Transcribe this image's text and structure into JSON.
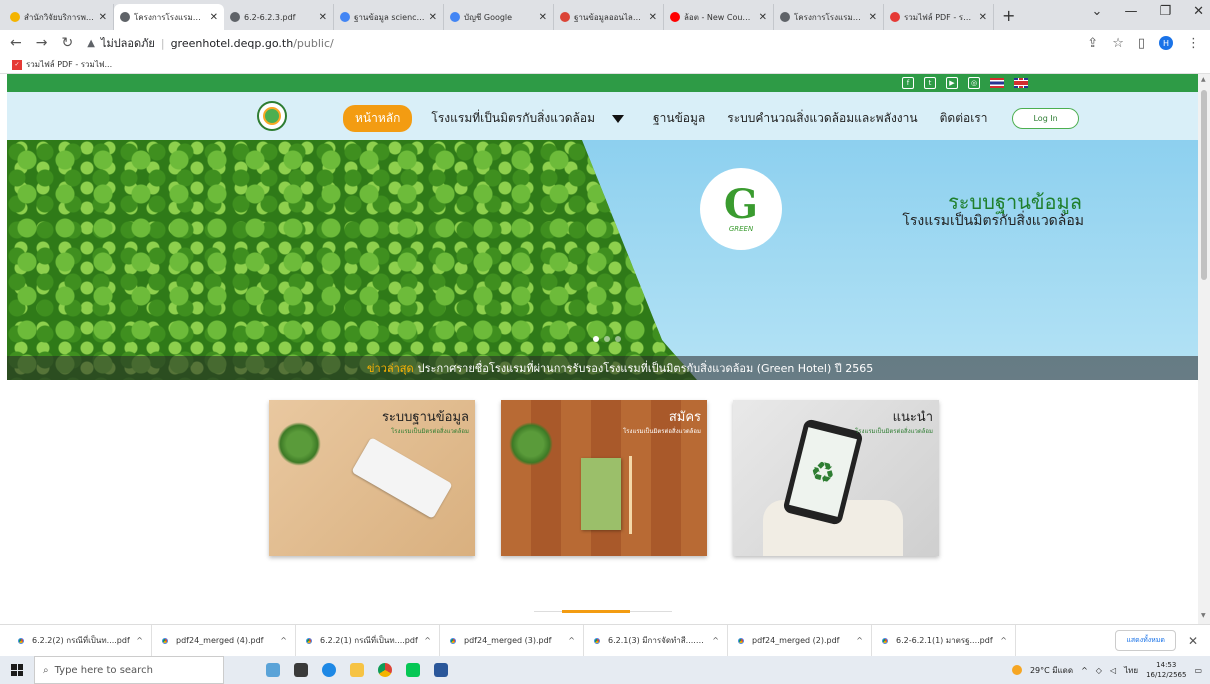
{
  "browser": {
    "tabs": [
      {
        "title": "สำนักวิจัยบริการพลังงานทด...",
        "color": "#f4b400",
        "active": false
      },
      {
        "title": "โครงการโรงแรมที่เป็นมิตร...",
        "color": "#5f6368",
        "active": true
      },
      {
        "title": "6.2-6.2.3.pdf",
        "color": "#5f6368",
        "active": false
      },
      {
        "title": "ฐานข้อมูล science direct",
        "color": "#4285f4",
        "active": false
      },
      {
        "title": "บัญชี Google",
        "color": "#4285f4",
        "active": false
      },
      {
        "title": "ฐานข้อมูลออนไลน์ของสำ...",
        "color": "#db4437",
        "active": false
      },
      {
        "title": "ล้อต - New Country [",
        "color": "#ff0000",
        "active": false
      },
      {
        "title": "โครงการโรงแรมที่เป็นมิตร...",
        "color": "#5f6368",
        "active": false
      },
      {
        "title": "รวมไฟล์ PDF - รวมไฟ",
        "color": "#e53935",
        "active": false
      }
    ],
    "new_tab": "+",
    "security_label": "ไม่ปลอดภัย",
    "url_host": "greenhotel.deqp.go.th",
    "url_path": "/public/",
    "bookmark": "รวมไฟล์ PDF - รวมไฟ..."
  },
  "site": {
    "menu": {
      "home": "หน้าหลัก",
      "friendly_hotels": "โรงแรมที่เป็นมิตรกับสิ่งแวดล้อม",
      "database": "ฐานข้อมูล",
      "calculator": "ระบบคำนวณสิ่งแวดล้อมและพลังงาน",
      "contact": "ติดต่อเรา",
      "login": "Log In"
    },
    "hero": {
      "logo_text": "GREEN",
      "title": "ระบบฐานข้อมูล",
      "subtitle": "โรงแรมเป็นมิตรกับสิ่งแวดล้อม",
      "news_label": "ข่าวล่าสุด",
      "news_text": "ประกาศรายชื่อโรงแรมที่ผ่านการรับรองโรงแรมที่เป็นมิตรกับสิ่งแวดล้อม (Green Hotel) ปี 2565"
    },
    "cards": [
      {
        "title": "ระบบฐานข้อมูล",
        "subtitle": "โรงแรมเป็นมิตรต่อสิ่งแวดล้อม"
      },
      {
        "title": "สมัคร",
        "subtitle": "โรงแรมเป็นมิตรต่อสิ่งแวดล้อม"
      },
      {
        "title": "แนะนำ",
        "subtitle": "โรงแรมเป็นมิตรต่อสิ่งแวดล้อม"
      }
    ]
  },
  "downloads": [
    "6.2.2(2) กรณีที่เป็นท....pdf",
    "pdf24_merged (4).pdf",
    "6.2.2(1) กรณีที่เป็นท....pdf",
    "pdf24_merged (3).pdf",
    "6.2.1(3) มีการจัดทำสี....pdf",
    "pdf24_merged (2).pdf",
    "6.2-6.2.1(1) มาตรฐ....pdf"
  ],
  "downloads_show_all": "แสดงทั้งหมด",
  "taskbar": {
    "search_placeholder": "Type here to search",
    "weather": "29°C มีแดด",
    "language": "ไทย",
    "time": "14:53",
    "date": "16/12/2565"
  }
}
